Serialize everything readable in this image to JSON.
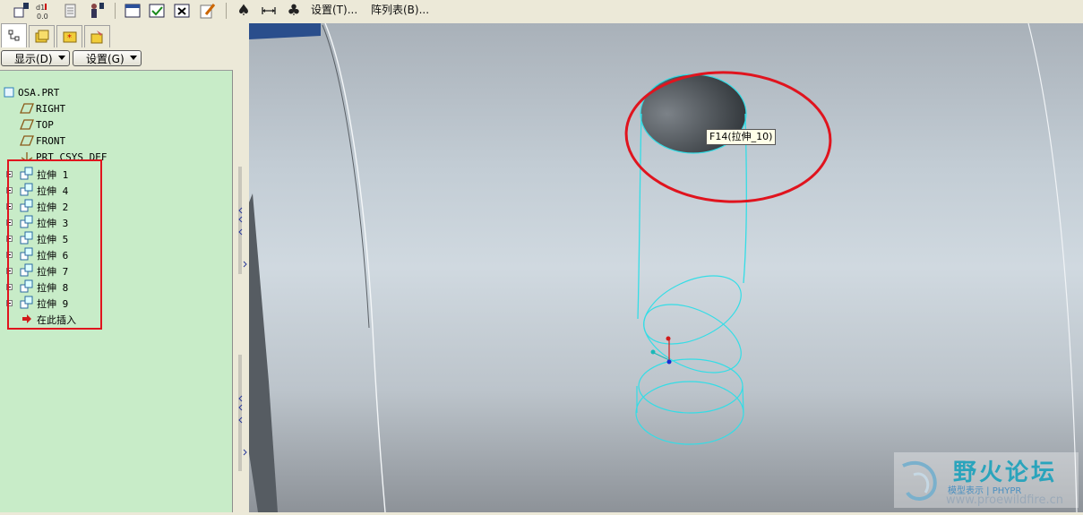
{
  "menu": {
    "settings": "设置(T)...",
    "pattern_table": "阵列表(B)..."
  },
  "panel": {
    "show_dropdown": "显示(D)",
    "settings_dropdown": "设置(G)"
  },
  "tree": {
    "root": "OSA.PRT",
    "datums": [
      "RIGHT",
      "TOP",
      "FRONT",
      "PRT_CSYS_DEF"
    ],
    "features": [
      "拉伸 1",
      "拉伸 4",
      "拉伸 2",
      "拉伸 3",
      "拉伸 5",
      "拉伸 6",
      "拉伸 7",
      "拉伸 8",
      "拉伸 9"
    ],
    "insert_here": "在此插入"
  },
  "viewport": {
    "tooltip": "F14(拉伸_10)"
  },
  "watermark": {
    "title": "野火论坛",
    "subtitle": "模型表示 | PHYPR",
    "url": "www.proewildfire.cn"
  },
  "colors": {
    "tree_bg": "#c8ecc8",
    "highlight_red": "#e0141e",
    "cyan_edges": "#33dde6"
  }
}
